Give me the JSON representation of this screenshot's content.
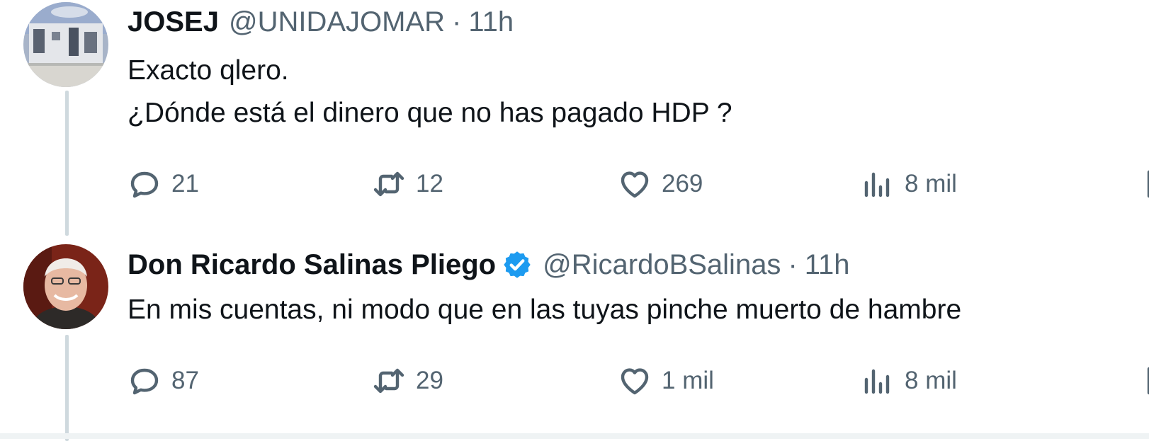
{
  "tweets": [
    {
      "author": {
        "name": "JOSEJ",
        "handle": "@UNIDAJOMAR",
        "verified": false,
        "avatar_icon": "building-photo-avatar"
      },
      "separator": "·",
      "time": "11h",
      "lines": [
        "Exacto qlero.",
        "¿Dónde está el dinero que no has pagado HDP ?"
      ],
      "metrics": {
        "replies": "21",
        "retweets": "12",
        "likes": "269",
        "views": "8 mil"
      }
    },
    {
      "author": {
        "name": "Don Ricardo Salinas Pliego",
        "handle": "@RicardoBSalinas",
        "verified": true,
        "avatar_icon": "person-photo-avatar"
      },
      "separator": "·",
      "time": "11h",
      "lines": [
        "En mis cuentas, ni modo que en las tuyas pinche muerto de hambre"
      ],
      "metrics": {
        "replies": "87",
        "retweets": "29",
        "likes": "1 mil",
        "views": "8 mil"
      }
    }
  ],
  "icons": {
    "reply": "reply-icon",
    "retweet": "retweet-icon",
    "like": "heart-icon",
    "views": "views-bar-chart-icon",
    "bookmark": "bookmark-icon",
    "verified": "verified-badge-icon"
  },
  "colors": {
    "text": "#0f1419",
    "secondary": "#536471",
    "verified_blue": "#1d9bf0",
    "thread_line": "#cfd9de"
  }
}
